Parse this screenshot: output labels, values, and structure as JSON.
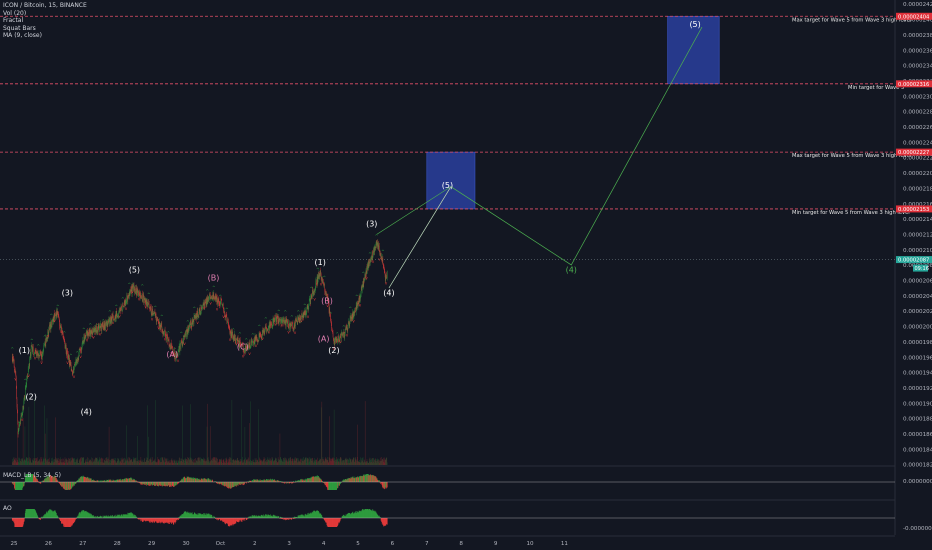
{
  "legend": {
    "symbol": "ICON / Bitcoin, 15, BINANCE",
    "indicators": [
      "Vol (20)",
      "Fractal",
      "Squat Bars",
      "MA (9, close)"
    ]
  },
  "macd_label": "MACD_LB (5, 34, 5)",
  "ao_label": "AO",
  "colors": {
    "background": "#131722",
    "up": "#2e9b3e",
    "down": "#e23a3a",
    "target_line": "#e5506a",
    "target_box": "#2a3f9e",
    "projection": "#4caf50",
    "wave_label": "#ffffff",
    "wave_label_purple": "#e27fb2",
    "price_tag": "#e0303a"
  },
  "chart_data": {
    "type": "line",
    "title": "",
    "x_ticks": [
      "25",
      "26",
      "27",
      "28",
      "29",
      "30",
      "Oct",
      "2",
      "3",
      "4",
      "5",
      "6",
      "7",
      "8",
      "9",
      "10",
      "11"
    ],
    "x_tick_days": [
      25,
      26,
      27,
      28,
      29,
      30,
      31,
      32,
      33,
      34,
      35,
      36,
      37,
      38,
      39,
      40,
      41
    ],
    "y_ticks": [
      "0.00002420",
      "0.00002400",
      "0.00002380",
      "0.00002360",
      "0.00002340",
      "0.00002320",
      "0.00002300",
      "0.00002280",
      "0.00002260",
      "0.00002240",
      "0.00002220",
      "0.00002200",
      "0.00002180",
      "0.00002160",
      "0.00002140",
      "0.00002120",
      "0.00002100",
      "0.00002080",
      "0.00002060",
      "0.00002040",
      "0.00002020",
      "0.00002000",
      "0.00001980",
      "0.00001960",
      "0.00001940",
      "0.00001920",
      "0.00001900",
      "0.00001880",
      "0.00001860",
      "0.00001840",
      "0.00001820"
    ],
    "ylim": [
      1.82e-05,
      2.42e-05
    ],
    "macd_ticks": [
      "0.00000000",
      "-0.00000050"
    ],
    "price_path": [
      {
        "x": 24.95,
        "y": 1.96e-05
      },
      {
        "x": 25.05,
        "y": 1.94e-05
      },
      {
        "x": 25.12,
        "y": 1.86e-05
      },
      {
        "x": 25.25,
        "y": 1.89e-05
      },
      {
        "x": 25.5,
        "y": 1.97e-05
      },
      {
        "x": 25.8,
        "y": 1.96e-05
      },
      {
        "x": 26.05,
        "y": 2e-05
      },
      {
        "x": 26.25,
        "y": 2.02e-05
      },
      {
        "x": 26.45,
        "y": 1.98e-05
      },
      {
        "x": 26.7,
        "y": 1.94e-05
      },
      {
        "x": 27.1,
        "y": 1.99e-05
      },
      {
        "x": 27.6,
        "y": 2e-05
      },
      {
        "x": 28.1,
        "y": 2.02e-05
      },
      {
        "x": 28.45,
        "y": 2.05e-05
      },
      {
        "x": 28.7,
        "y": 2.04e-05
      },
      {
        "x": 29.0,
        "y": 2.02e-05
      },
      {
        "x": 29.4,
        "y": 1.99e-05
      },
      {
        "x": 29.7,
        "y": 1.96e-05
      },
      {
        "x": 30.1,
        "y": 2e-05
      },
      {
        "x": 30.7,
        "y": 2.04e-05
      },
      {
        "x": 31.05,
        "y": 2.03e-05
      },
      {
        "x": 31.3,
        "y": 1.99e-05
      },
      {
        "x": 31.7,
        "y": 1.97e-05
      },
      {
        "x": 32.2,
        "y": 1.99e-05
      },
      {
        "x": 32.6,
        "y": 2.01e-05
      },
      {
        "x": 33.1,
        "y": 2e-05
      },
      {
        "x": 33.5,
        "y": 2.02e-05
      },
      {
        "x": 33.9,
        "y": 2.07e-05
      },
      {
        "x": 34.1,
        "y": 2.04e-05
      },
      {
        "x": 34.3,
        "y": 1.98e-05
      },
      {
        "x": 34.6,
        "y": 1.99e-05
      },
      {
        "x": 35.0,
        "y": 2.03e-05
      },
      {
        "x": 35.3,
        "y": 2.08e-05
      },
      {
        "x": 35.55,
        "y": 2.11e-05
      },
      {
        "x": 35.7,
        "y": 2.09e-05
      },
      {
        "x": 35.8,
        "y": 2.06e-05
      },
      {
        "x": 35.85,
        "y": 2.07e-05
      }
    ],
    "price_range_band": [
      1.85e-05,
      2.13e-05
    ],
    "wave_labels": [
      {
        "text": "(1)",
        "x": 25.3,
        "y": 1.965e-05,
        "color": "white"
      },
      {
        "text": "(2)",
        "x": 25.5,
        "y": 1.905e-05,
        "color": "white"
      },
      {
        "text": "(3)",
        "x": 26.55,
        "y": 2.04e-05,
        "color": "white"
      },
      {
        "text": "(4)",
        "x": 27.1,
        "y": 1.885e-05,
        "color": "white"
      },
      {
        "text": "(5)",
        "x": 28.5,
        "y": 2.07e-05,
        "color": "white"
      },
      {
        "text": "(A)",
        "x": 29.6,
        "y": 1.96e-05,
        "color": "purple"
      },
      {
        "text": "(B)",
        "x": 30.8,
        "y": 2.06e-05,
        "color": "purple"
      },
      {
        "text": "(C)",
        "x": 31.65,
        "y": 1.97e-05,
        "color": "purple"
      },
      {
        "text": "(1)",
        "x": 33.9,
        "y": 2.08e-05,
        "color": "white"
      },
      {
        "text": "(B)",
        "x": 34.1,
        "y": 2.03e-05,
        "color": "purple"
      },
      {
        "text": "(A)",
        "x": 34.0,
        "y": 1.98e-05,
        "color": "purple"
      },
      {
        "text": "(2)",
        "x": 34.3,
        "y": 1.965e-05,
        "color": "white"
      },
      {
        "text": "(3)",
        "x": 35.4,
        "y": 2.13e-05,
        "color": "white"
      },
      {
        "text": "(4)",
        "x": 35.9,
        "y": 2.04e-05,
        "color": "white"
      },
      {
        "text": "(5)",
        "x": 37.6,
        "y": 2.18e-05,
        "color": "white"
      },
      {
        "text": "(4)",
        "x": 41.2,
        "y": 2.07e-05,
        "color": "projection"
      },
      {
        "text": "(5)",
        "x": 44.8,
        "y": 2.39e-05,
        "color": "white"
      }
    ],
    "projection_path": [
      {
        "x": 35.9,
        "y": 2.05e-05
      },
      {
        "x": 37.7,
        "y": 2.182e-05
      },
      {
        "x": 41.2,
        "y": 2.08e-05
      },
      {
        "x": 45.0,
        "y": 2.39e-05
      }
    ],
    "projection_start": {
      "x": 35.55,
      "y": 2.12e-05
    },
    "target_lines": [
      {
        "value": 2.404e-05,
        "label": "Max target for Wave 5 from Wave 3 high level",
        "price_tag": "0.00002404"
      },
      {
        "value": 2.316e-05,
        "label": "Min target for Wave 5",
        "price_tag": "0.00002316"
      },
      {
        "value": 2.227e-05,
        "label": "Max target for Wave 5 from Wave 3 high level",
        "price_tag": "0.00002227"
      },
      {
        "value": 2.153e-05,
        "label": "Min target for Wave 5 from Wave 3 high level",
        "price_tag": "0.00002153"
      }
    ],
    "target_boxes": [
      {
        "x0": 37.0,
        "x1": 38.4,
        "y0": 2.153e-05,
        "y1": 2.227e-05
      },
      {
        "x0": 44.0,
        "x1": 45.5,
        "y0": 2.316e-05,
        "y1": 2.404e-05
      }
    ],
    "current_price": {
      "value": 2.087e-05,
      "label": "0.00002087",
      "countdown": "09:16"
    }
  }
}
